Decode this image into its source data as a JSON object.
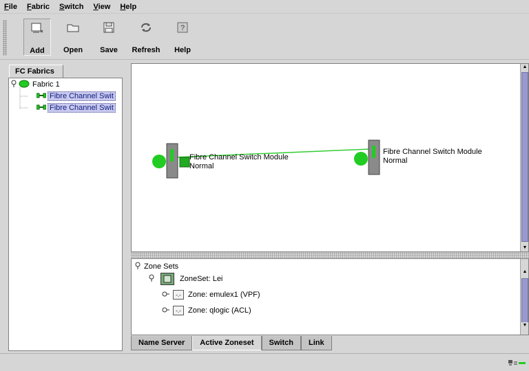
{
  "menu": {
    "file": "File",
    "fabric": "Fabric",
    "switch": "Switch",
    "view": "View",
    "help": "Help"
  },
  "toolbar": {
    "add": "Add",
    "open": "Open",
    "save": "Save",
    "refresh": "Refresh",
    "help": "Help"
  },
  "left_panel": {
    "tab_label": "FC Fabrics",
    "tree": {
      "root": "Fabric 1",
      "children": [
        "Fibre Channel Swit",
        "Fibre Channel Swit"
      ]
    }
  },
  "topology": {
    "nodes": [
      {
        "name": "Fibre Channel Switch Module",
        "status": "Normal"
      },
      {
        "name": "Fibre Channel Switch Module",
        "status": "Normal"
      }
    ]
  },
  "zones": {
    "root": "Zone Sets",
    "zoneset": "ZoneSet: Lei",
    "items": [
      "Zone: emulex1 (VPF)",
      "Zone: qlogic (ACL)"
    ]
  },
  "bottom_tabs": [
    "Name Server",
    "Active Zoneset",
    "Switch",
    "Link"
  ],
  "colors": {
    "link_green": "#22cc22",
    "selection": "#c8c8ee",
    "scroll_thumb": "#9999cc"
  }
}
